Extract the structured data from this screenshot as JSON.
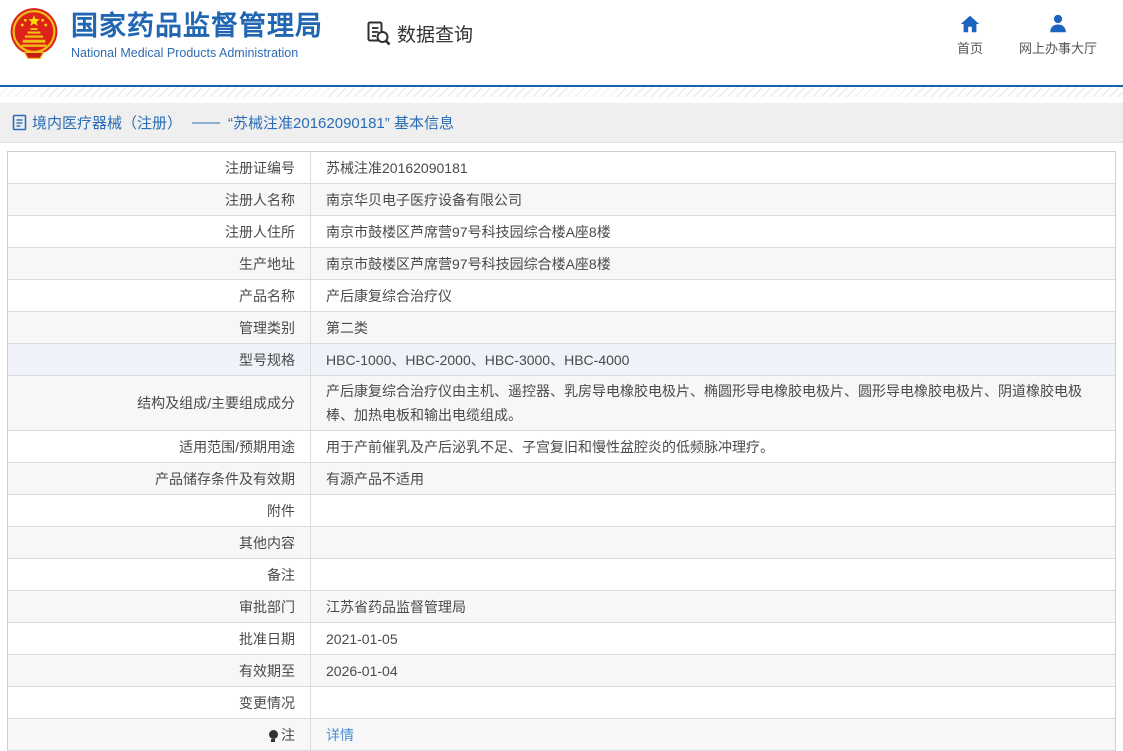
{
  "brand": {
    "title": "国家药品监督管理局",
    "subtitle": "National Medical Products Administration",
    "emblem_icon": "china-national-emblem"
  },
  "nav": {
    "data_query": "数据查询",
    "home": "首页",
    "service_hall": "网上办事大厅"
  },
  "breadcrumb": {
    "category": "境内医疗器械（注册）",
    "dash": "——",
    "detail": "“苏械注准20162090181” 基本信息"
  },
  "table": {
    "rows": [
      {
        "label": "注册证编号",
        "value": "苏械注准20162090181"
      },
      {
        "label": "注册人名称",
        "value": "南京华贝电子医疗设备有限公司"
      },
      {
        "label": "注册人住所",
        "value": "南京市鼓楼区芦席营97号科技园综合楼A座8楼"
      },
      {
        "label": "生产地址",
        "value": "南京市鼓楼区芦席营97号科技园综合楼A座8楼"
      },
      {
        "label": "产品名称",
        "value": "产后康复综合治疗仪"
      },
      {
        "label": "管理类别",
        "value": "第二类"
      },
      {
        "label": "型号规格",
        "value": "HBC-1000、HBC-2000、HBC-3000、HBC-4000",
        "highlight": true
      },
      {
        "label": "结构及组成/主要组成成分",
        "value": "产后康复综合治疗仪由主机、遥控器、乳房导电橡胶电极片、椭圆形导电橡胶电极片、圆形导电橡胶电极片、阴道橡胶电极棒、加热电板和输出电缆组成。",
        "tall": true
      },
      {
        "label": "适用范围/预期用途",
        "value": "用于产前催乳及产后泌乳不足、子宫复旧和慢性盆腔炎的低频脉冲理疗。"
      },
      {
        "label": "产品储存条件及有效期",
        "value": "有源产品不适用"
      },
      {
        "label": "附件",
        "value": ""
      },
      {
        "label": "其他内容",
        "value": ""
      },
      {
        "label": "备注",
        "value": ""
      },
      {
        "label": "审批部门",
        "value": "江苏省药品监督管理局"
      },
      {
        "label": "批准日期",
        "value": "2021-01-05"
      },
      {
        "label": "有效期至",
        "value": "2026-01-04"
      },
      {
        "label": "变更情况",
        "value": ""
      },
      {
        "label": "注",
        "value": "详情",
        "link": true,
        "note_icon": true
      }
    ]
  },
  "colors": {
    "brand_blue": "#2166b2",
    "icon_blue": "#1d63c0",
    "rule_blue": "#1a63ad",
    "breadcrumb_text": "#2a6cb5",
    "breadcrumb_bg": "#efefef",
    "link_blue": "#4a90d8",
    "row_alt_bg": "#f7f7f7",
    "row_highlight_bg": "#eff2f8",
    "border_gray": "#dcdcdc",
    "text_gray": "#4a4a4a"
  }
}
